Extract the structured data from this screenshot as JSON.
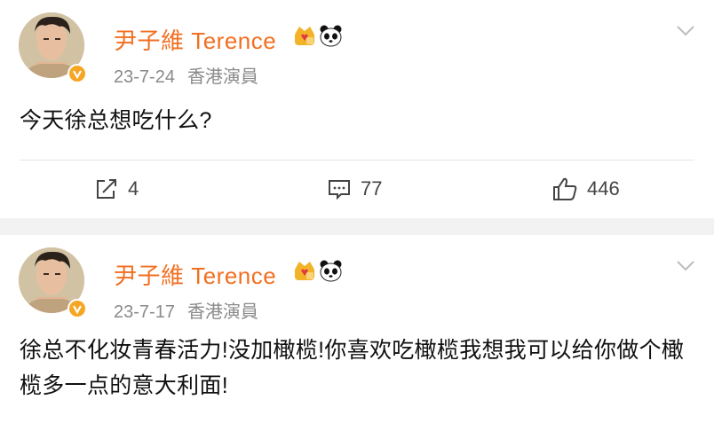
{
  "posts": [
    {
      "author": "尹子維 Terence",
      "date": "23-7-24",
      "source": "香港演員",
      "content": "今天徐总想吃什么?",
      "actions": {
        "repost": "4",
        "comment": "77",
        "like": "446"
      }
    },
    {
      "author": "尹子維 Terence",
      "date": "23-7-17",
      "source": "香港演員",
      "content": "徐总不化妆青春活力!没加橄榄!你喜欢吃橄榄我想我可以给你做个橄榄多一点的意大利面!"
    }
  ],
  "icons": {
    "verified": "verified-badge-icon",
    "crown": "crown-badge-icon",
    "panda": "panda-badge-icon",
    "menu": "chevron-down-icon",
    "repost": "repost-icon",
    "comment": "comment-icon",
    "like": "like-icon"
  },
  "colors": {
    "author": "#f26f21",
    "verified": "#f6a623",
    "meta": "#8a8a8a"
  }
}
